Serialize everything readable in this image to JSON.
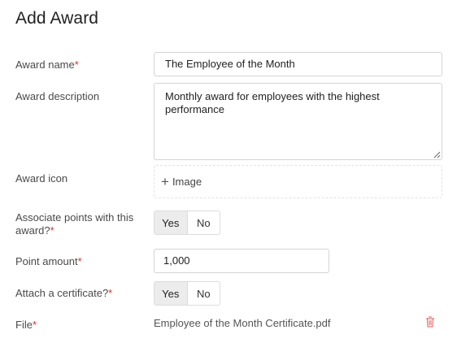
{
  "page": {
    "title": "Add Award"
  },
  "form": {
    "award_name": {
      "label": "Award name",
      "required": "*",
      "value": "The Employee of the Month"
    },
    "award_description": {
      "label": "Award description",
      "value": "Monthly award for employees with the highest performance"
    },
    "award_icon": {
      "label": "Award icon",
      "button_label": "Image",
      "icon": "plus-icon"
    },
    "associate_points": {
      "label": "Associate points with this award?",
      "required": "*",
      "options": [
        "Yes",
        "No"
      ],
      "selected": "Yes"
    },
    "point_amount": {
      "label": "Point amount",
      "required": "*",
      "value": "1,000"
    },
    "attach_certificate": {
      "label": "Attach a certificate?",
      "required": "*",
      "options": [
        "Yes",
        "No"
      ],
      "selected": "Yes"
    },
    "file": {
      "label": "File",
      "required": "*",
      "file_name": "Employee of the Month Certificate.pdf",
      "delete_icon": "trash-icon"
    }
  },
  "colors": {
    "required": "#d93030",
    "delete": "#e05a5a",
    "toggle_active_bg": "#ececec"
  }
}
